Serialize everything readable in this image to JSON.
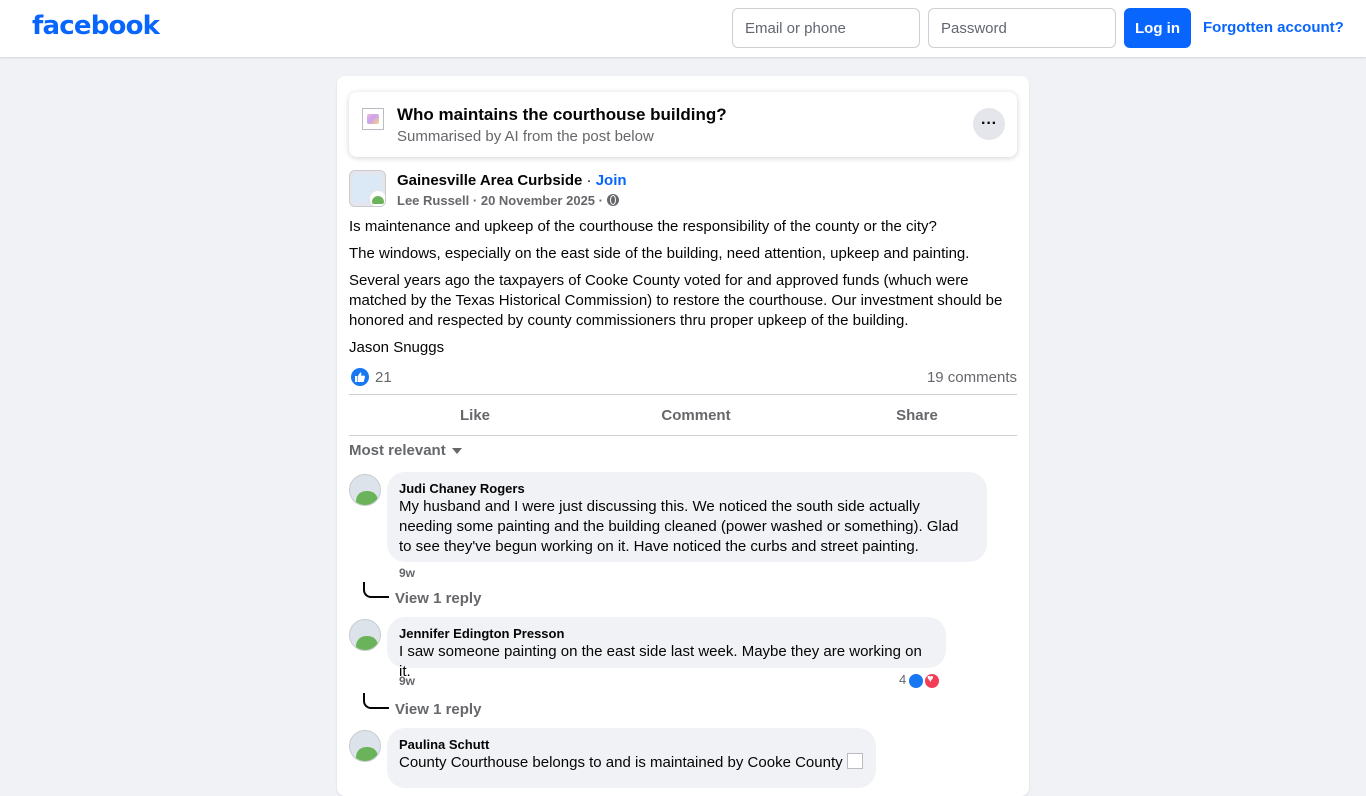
{
  "header": {
    "logo": "facebook",
    "email_placeholder": "Email or phone",
    "password_placeholder": "Password",
    "login_label": "Log in",
    "forgot_label": "Forgotten account?"
  },
  "ai_summary": {
    "title": "Who maintains the courthouse building?",
    "subtitle": "Summarised by AI from the post below",
    "more_label": "···"
  },
  "post": {
    "group_name": "Gainesville Area Curbside",
    "separator": " · ",
    "join_label": "Join",
    "author": "Lee Russell",
    "date": "20 November 2025",
    "paragraphs": [
      "Is maintenance and upkeep of the courthouse the responsibility of the county or the city?",
      "The windows, especially on the east side of the building, need attention, upkeep and painting.",
      "Several years ago the taxpayers of Cooke County voted for and approved funds (whuch were matched by the Texas Historical Commission) to restore the courthouse. Our investment should be honored and respected by county commissioners thru proper upkeep of the building.",
      "Jason Snuggs"
    ],
    "reaction_count": "21",
    "comment_count": "19 comments"
  },
  "actions": {
    "like": "Like",
    "comment": "Comment",
    "share": "Share"
  },
  "sort_label": "Most relevant",
  "comments": [
    {
      "name": "Judi Chaney Rogers",
      "text": "My husband and I were just discussing this. We noticed the south side actually needing some painting and the building cleaned (power washed or something). Glad to see they've begun working on it. Have noticed the curbs and street painting.",
      "time": "9w",
      "reply_label": "View 1 reply"
    },
    {
      "name": "Jennifer Edington Presson",
      "text": "I saw someone painting on the east side last week. Maybe they are working on it.",
      "time": "9w",
      "reply_label": "View 1 reply",
      "reaction_count": "4"
    },
    {
      "name": "Paulina Schutt",
      "text": "County Courthouse belongs to and is maintained by Cooke County"
    }
  ],
  "colors": {
    "brand": "#0866ff",
    "background": "#f0f2f5",
    "secondary_text": "#65676b",
    "like_blue": "#1877f2",
    "love_red": "#f33e58"
  }
}
